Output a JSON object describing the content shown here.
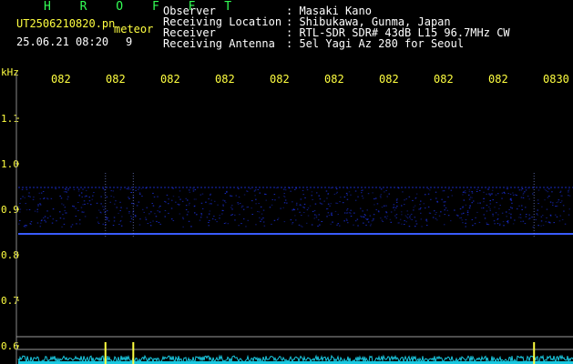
{
  "header": {
    "station": "H R O F F T",
    "filename": "UT2506210820.pn",
    "tag": "meteor",
    "datetime": "25.06.21 08:20",
    "count": "9",
    "info_labels": [
      "Observer",
      "Receiving Location",
      "Receiver",
      "Receiving Antenna"
    ],
    "info_values": [
      ": Masaki Kano",
      ": Shibukawa, Gunma, Japan",
      ": RTL-SDR SDR# 43dB L15 96.7MHz CW",
      ": 5el Yagi Az 280 for Seoul"
    ]
  },
  "chart_data": {
    "type": "heatmap",
    "ylabel": "kHz",
    "y_ticks": [
      "1.1",
      "1.0",
      "0.9",
      "0.8",
      "0.7",
      "0.6"
    ],
    "y_values": [
      1.1,
      1.0,
      0.9,
      0.8,
      0.7,
      0.6
    ],
    "x_ticks": [
      "082",
      "082",
      "082",
      "082",
      "082",
      "082",
      "082",
      "082",
      "082",
      "0830"
    ],
    "ylim": [
      0.59,
      1.2
    ],
    "carrier_line_khz": 0.846,
    "band_khz": [
      0.862,
      0.948
    ],
    "meteor_events_x_fraction": [
      0.16,
      0.21,
      0.93
    ],
    "colors": {
      "background": "#000000",
      "carrier": "#3a5cff",
      "noise": "#1b2fd6",
      "lower_panel": "#19c8e0",
      "spike": "#ffff40",
      "axis_text": "#ffff40"
    }
  }
}
